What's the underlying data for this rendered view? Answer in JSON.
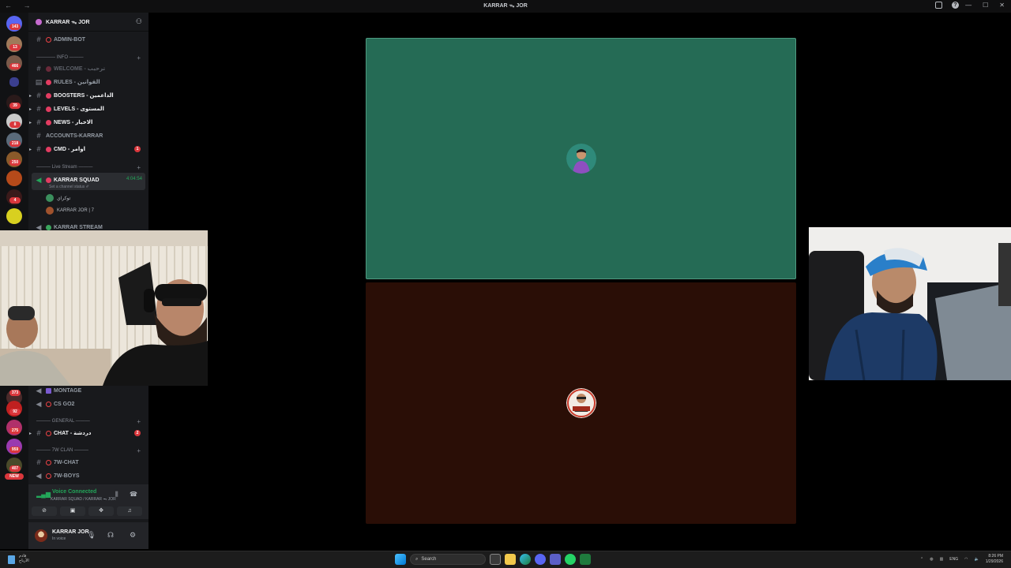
{
  "window": {
    "title": "KARRAR ᯓ JOR",
    "nav_glyphs": "← →"
  },
  "server": {
    "name": "KARRAR ᯓ JOR",
    "rail_badges": [
      "143",
      "13",
      "466",
      "39",
      "8",
      "218",
      "250",
      "4",
      "373",
      "92",
      "275",
      "959",
      "407",
      "NEW"
    ]
  },
  "channels": {
    "admin_bot": "ADMIN-BOT",
    "cat_info": "———— INFO ———",
    "welcome": "WELCOME - ترحيب",
    "rules": "RULES - القوانين",
    "boosters": "BOOSTERS - الداعمين",
    "levels": "LEVELS - المستوى",
    "news": "NEWS - الاخبار",
    "accounts": "ACCOUNTS-KARRAR",
    "cmd": "CMD - اوامر",
    "cmd_badge": "1",
    "cat_live": "——— Live Stream ———",
    "karrar_squad": "KARRAR SQUAD",
    "squad_timer": "4:04:54",
    "squad_status": "Set a channel status ✐",
    "voice_user_1": "توكراي",
    "voice_user_2": "KARRAR JOR | 7",
    "karrar_stream": "KARRAR STREAM",
    "montage": "MONTAGE",
    "csgo": "CS GO2",
    "cat_general": "——— GENERAL ———",
    "chat": "CHAT - دردشة",
    "chat_badge": "2",
    "cat_7w": "——— 7W CLAN ———",
    "w_chat": "7W-CHAT",
    "w_boys": "7W-BOYS"
  },
  "voice_panel": {
    "title": "Voice Connected",
    "subtitle": "KARRAR SQUAD / KARRAR ᯓ JOR"
  },
  "user_panel": {
    "name": "KARRAR JOR",
    "status": "In voice"
  },
  "taskbar": {
    "weather_line1": "قادم",
    "weather_line2": "الأرباح",
    "search_placeholder": "Search",
    "lang": "ENG",
    "time": "8:26 PM",
    "date": "1/29/2026"
  },
  "colors": {
    "tile_top": "#256b55",
    "tile_bottom": "#2a0e06",
    "voice_green": "#23a559",
    "badge_red": "#da373c"
  }
}
